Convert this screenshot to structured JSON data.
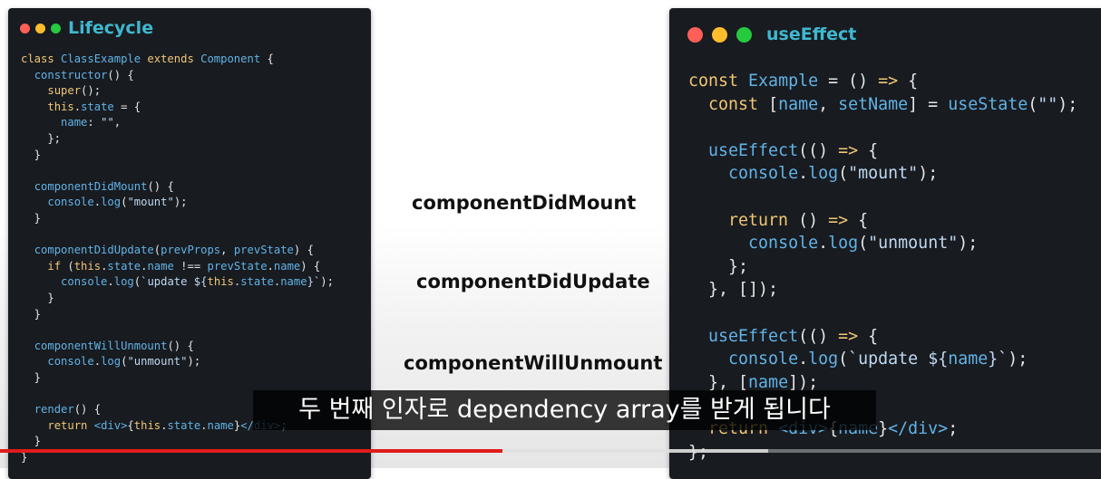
{
  "left_window": {
    "title": "Lifecycle",
    "code": [
      [
        [
          "kw",
          "class "
        ],
        [
          "fn",
          "ClassExample "
        ],
        [
          "kw",
          "extends "
        ],
        [
          "fn",
          "Component "
        ],
        [
          "pn",
          "{"
        ]
      ],
      [
        [
          "pn",
          "  "
        ],
        [
          "fn",
          "constructor"
        ],
        [
          "pn",
          "() {"
        ]
      ],
      [
        [
          "pn",
          "    "
        ],
        [
          "kw",
          "super"
        ],
        [
          "pn",
          "();"
        ]
      ],
      [
        [
          "pn",
          "    "
        ],
        [
          "th",
          "this"
        ],
        [
          "pn",
          "."
        ],
        [
          "fn",
          "state"
        ],
        [
          "pn",
          " = {"
        ]
      ],
      [
        [
          "pn",
          "      "
        ],
        [
          "fn",
          "name"
        ],
        [
          "pn",
          ": "
        ],
        [
          "str",
          "\"\""
        ],
        [
          "pn",
          ","
        ]
      ],
      [
        [
          "pn",
          "    };"
        ]
      ],
      [
        [
          "pn",
          "  }"
        ]
      ],
      [
        [
          "pn",
          ""
        ]
      ],
      [
        [
          "pn",
          "  "
        ],
        [
          "fn",
          "componentDidMount"
        ],
        [
          "pn",
          "() {"
        ]
      ],
      [
        [
          "pn",
          "    "
        ],
        [
          "fn",
          "console"
        ],
        [
          "pn",
          "."
        ],
        [
          "fn",
          "log"
        ],
        [
          "pn",
          "("
        ],
        [
          "str",
          "\"mount\""
        ],
        [
          "pn",
          ");"
        ]
      ],
      [
        [
          "pn",
          "  }"
        ]
      ],
      [
        [
          "pn",
          ""
        ]
      ],
      [
        [
          "pn",
          "  "
        ],
        [
          "fn",
          "componentDidUpdate"
        ],
        [
          "pn",
          "("
        ],
        [
          "fn",
          "prevProps"
        ],
        [
          "pn",
          ", "
        ],
        [
          "fn",
          "prevState"
        ],
        [
          "pn",
          ") {"
        ]
      ],
      [
        [
          "pn",
          "    "
        ],
        [
          "kw",
          "if "
        ],
        [
          "pn",
          "("
        ],
        [
          "th",
          "this"
        ],
        [
          "pn",
          "."
        ],
        [
          "fn",
          "state"
        ],
        [
          "pn",
          "."
        ],
        [
          "fn",
          "name"
        ],
        [
          "pn",
          " !== "
        ],
        [
          "fn",
          "prevState"
        ],
        [
          "pn",
          "."
        ],
        [
          "fn",
          "name"
        ],
        [
          "pn",
          ") {"
        ]
      ],
      [
        [
          "pn",
          "      "
        ],
        [
          "fn",
          "console"
        ],
        [
          "pn",
          "."
        ],
        [
          "fn",
          "log"
        ],
        [
          "pn",
          "("
        ],
        [
          "str",
          "`update ${"
        ],
        [
          "th",
          "this"
        ],
        [
          "str",
          "."
        ],
        [
          "fn",
          "state"
        ],
        [
          "str",
          "."
        ],
        [
          "fn",
          "name"
        ],
        [
          "str",
          "}`"
        ],
        [
          "pn",
          ");"
        ]
      ],
      [
        [
          "pn",
          "    }"
        ]
      ],
      [
        [
          "pn",
          "  }"
        ]
      ],
      [
        [
          "pn",
          ""
        ]
      ],
      [
        [
          "pn",
          "  "
        ],
        [
          "fn",
          "componentWillUnmount"
        ],
        [
          "pn",
          "() {"
        ]
      ],
      [
        [
          "pn",
          "    "
        ],
        [
          "fn",
          "console"
        ],
        [
          "pn",
          "."
        ],
        [
          "fn",
          "log"
        ],
        [
          "pn",
          "("
        ],
        [
          "str",
          "\"unmount\""
        ],
        [
          "pn",
          ");"
        ]
      ],
      [
        [
          "pn",
          "  }"
        ]
      ],
      [
        [
          "pn",
          ""
        ]
      ],
      [
        [
          "pn",
          "  "
        ],
        [
          "fn",
          "render"
        ],
        [
          "pn",
          "() {"
        ]
      ],
      [
        [
          "pn",
          "    "
        ],
        [
          "kw",
          "return "
        ],
        [
          "fn",
          "<div>"
        ],
        [
          "pn",
          "{"
        ],
        [
          "th",
          "this"
        ],
        [
          "pn",
          "."
        ],
        [
          "fn",
          "state"
        ],
        [
          "pn",
          "."
        ],
        [
          "fn",
          "name"
        ],
        [
          "pn",
          "}"
        ],
        [
          "fn",
          "</div>"
        ],
        [
          "pn",
          ";"
        ]
      ],
      [
        [
          "pn",
          "  }"
        ]
      ],
      [
        [
          "pn",
          "}"
        ]
      ]
    ]
  },
  "right_window": {
    "title": "useEffect",
    "code": [
      [
        [
          "kw",
          "const "
        ],
        [
          "fn",
          "Example"
        ],
        [
          "pn",
          " = () "
        ],
        [
          "kw",
          "=> "
        ],
        [
          "pn",
          "{"
        ]
      ],
      [
        [
          "pn",
          "  "
        ],
        [
          "kw",
          "const "
        ],
        [
          "pn",
          "["
        ],
        [
          "fn",
          "name"
        ],
        [
          "pn",
          ", "
        ],
        [
          "fn",
          "setName"
        ],
        [
          "pn",
          "] = "
        ],
        [
          "fn",
          "useState"
        ],
        [
          "pn",
          "("
        ],
        [
          "str",
          "\"\""
        ],
        [
          "pn",
          ");"
        ]
      ],
      [
        [
          "pn",
          ""
        ]
      ],
      [
        [
          "pn",
          "  "
        ],
        [
          "fn",
          "useEffect"
        ],
        [
          "pn",
          "(() "
        ],
        [
          "kw",
          "=> "
        ],
        [
          "pn",
          "{"
        ]
      ],
      [
        [
          "pn",
          "    "
        ],
        [
          "fn",
          "console"
        ],
        [
          "pn",
          "."
        ],
        [
          "fn",
          "log"
        ],
        [
          "pn",
          "("
        ],
        [
          "str",
          "\"mount\""
        ],
        [
          "pn",
          ");"
        ]
      ],
      [
        [
          "pn",
          ""
        ]
      ],
      [
        [
          "pn",
          "    "
        ],
        [
          "kw",
          "return "
        ],
        [
          "pn",
          "() "
        ],
        [
          "kw",
          "=> "
        ],
        [
          "pn",
          "{"
        ]
      ],
      [
        [
          "pn",
          "      "
        ],
        [
          "fn",
          "console"
        ],
        [
          "pn",
          "."
        ],
        [
          "fn",
          "log"
        ],
        [
          "pn",
          "("
        ],
        [
          "str",
          "\"unmount\""
        ],
        [
          "pn",
          ");"
        ]
      ],
      [
        [
          "pn",
          "    };"
        ]
      ],
      [
        [
          "pn",
          "  }, []);"
        ]
      ],
      [
        [
          "pn",
          ""
        ]
      ],
      [
        [
          "pn",
          "  "
        ],
        [
          "fn",
          "useEffect"
        ],
        [
          "pn",
          "(() "
        ],
        [
          "kw",
          "=> "
        ],
        [
          "pn",
          "{"
        ]
      ],
      [
        [
          "pn",
          "    "
        ],
        [
          "fn",
          "console"
        ],
        [
          "pn",
          "."
        ],
        [
          "fn",
          "log"
        ],
        [
          "pn",
          "("
        ],
        [
          "str",
          "`update ${"
        ],
        [
          "fn",
          "name"
        ],
        [
          "str",
          "}`"
        ],
        [
          "pn",
          ");"
        ]
      ],
      [
        [
          "pn",
          "  }, ["
        ],
        [
          "fn",
          "name"
        ],
        [
          "pn",
          "]);"
        ]
      ],
      [
        [
          "pn",
          ""
        ]
      ],
      [
        [
          "pn",
          "  "
        ],
        [
          "kw",
          "return "
        ],
        [
          "fn",
          "<div>"
        ],
        [
          "pn",
          "{"
        ],
        [
          "fn",
          "name"
        ],
        [
          "pn",
          "}"
        ],
        [
          "fn",
          "</div>"
        ],
        [
          "pn",
          ";"
        ]
      ],
      [
        [
          "pn",
          "};"
        ]
      ]
    ]
  },
  "lifecycle_labels": {
    "mount": "componentDidMount",
    "update": "componentDidUpdate",
    "unmount": "componentWillUnmount"
  },
  "subtitle": "두 번째 인자로 dependency array를 받게 됩니다",
  "video_progress": {
    "played_fraction": 0.456,
    "buffered_fraction": 0.698
  },
  "colors": {
    "dot_red": "#ff5f56",
    "dot_yellow": "#ffbd2e",
    "dot_green": "#27c93f",
    "progress_red": "#e01b1b"
  }
}
